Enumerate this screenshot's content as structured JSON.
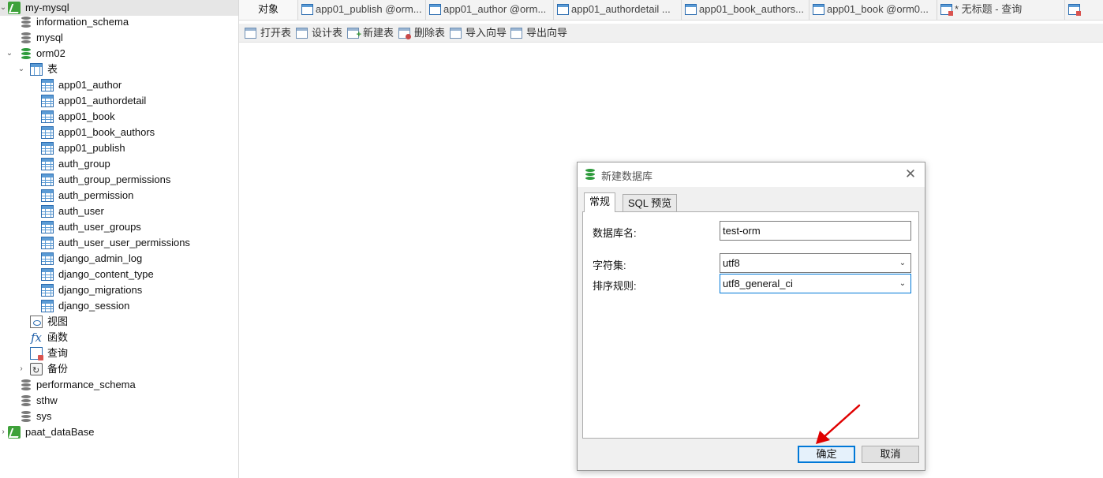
{
  "tree": {
    "connection": "my-mysql",
    "databases": [
      "information_schema",
      "mysql"
    ],
    "active_db": "orm02",
    "tables_folder": "表",
    "tables": [
      "app01_author",
      "app01_authordetail",
      "app01_book",
      "app01_book_authors",
      "app01_publish",
      "auth_group",
      "auth_group_permissions",
      "auth_permission",
      "auth_user",
      "auth_user_groups",
      "auth_user_user_permissions",
      "django_admin_log",
      "django_content_type",
      "django_migrations",
      "django_session"
    ],
    "views": "视图",
    "functions": "函数",
    "queries": "查询",
    "backups": "备份",
    "other_databases": [
      "performance_schema",
      "sthw",
      "sys"
    ],
    "connection2": "paat_dataBase",
    "fx_glyph": "fx"
  },
  "tabs": {
    "objects": "对象",
    "items": [
      "app01_publish @orm...",
      "app01_author @orm...",
      "app01_authordetail ...",
      "app01_book_authors...",
      "app01_book @orm0...",
      "* 无标题 - 查询",
      ""
    ]
  },
  "toolbar": {
    "open": "打开表",
    "design": "设计表",
    "new": "新建表",
    "delete": "删除表",
    "import": "导入向导",
    "export": "导出向导"
  },
  "dialog": {
    "title": "新建数据库",
    "close_glyph": "✕",
    "tabs": [
      "常规",
      "SQL 预览"
    ],
    "db_name_label": "数据库名:",
    "db_name_value": "test-orm",
    "charset_label": "字符集:",
    "charset_value": "utf8",
    "collation_label": "排序规则:",
    "collation_value": "utf8_general_ci",
    "ok": "确定",
    "cancel": "取消"
  },
  "icons": {
    "expand": "chevron-down-icon",
    "collapse": "chevron-right-icon",
    "annotation": "red-arrow-icon"
  },
  "colors": {
    "accent": "#0078d7",
    "mysql_green": "#3ea13a",
    "annotation_red": "#e00000",
    "selected_row": "#e6e6e6"
  }
}
